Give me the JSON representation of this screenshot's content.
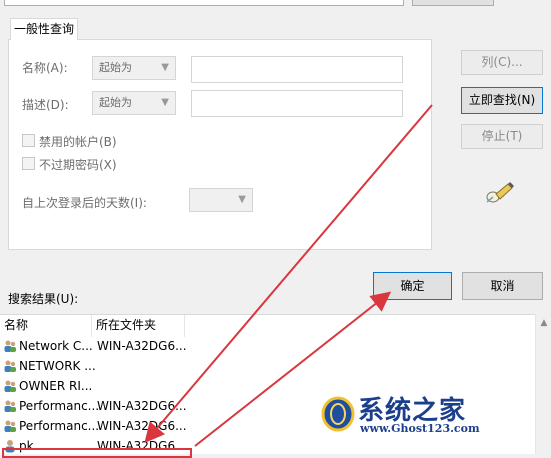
{
  "tab": {
    "label": "一般性查询"
  },
  "query": {
    "name_label": "名称(A):",
    "name_mode": "起始为",
    "desc_label": "描述(D):",
    "desc_mode": "起始为",
    "disabled_accounts": "禁用的帐户(B)",
    "no_expire_password": "不过期密码(X)",
    "days_since_logon": "自上次登录后的天数(I):"
  },
  "side_buttons": {
    "columns": "列(C)...",
    "find_now": "立即查找(N)",
    "stop": "停止(T)"
  },
  "dialog_buttons": {
    "ok": "确定",
    "cancel": "取消"
  },
  "results": {
    "label": "搜索结果(U):",
    "columns": [
      "名称",
      "所在文件夹"
    ],
    "rows": [
      {
        "name": "Network C...",
        "folder": "WIN-A32DG6..."
      },
      {
        "name": "NETWORK ...",
        "folder": ""
      },
      {
        "name": "OWNER RI...",
        "folder": ""
      },
      {
        "name": "Performanc...",
        "folder": "WIN-A32DG6..."
      },
      {
        "name": "Performanc...",
        "folder": "WIN-A32DG6..."
      },
      {
        "name": "pk",
        "folder": "WIN-A32DG6..."
      }
    ]
  },
  "watermark": {
    "title": "系统之家",
    "url": "www.Ghost123.com"
  },
  "colors": {
    "arrow": "#d9363e",
    "focus": "#0078d7",
    "watermark": "#1c3f8c"
  }
}
